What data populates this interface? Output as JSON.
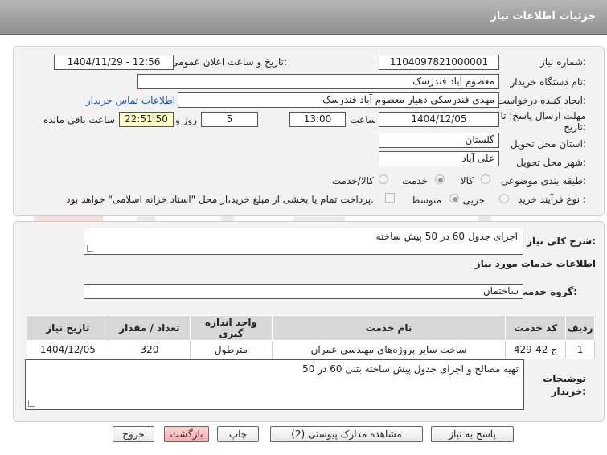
{
  "header": {
    "title": "جزئیات اطلاعات نیاز"
  },
  "fields": {
    "need_number_label": "شماره نیاز:",
    "need_number": "1104097821000001",
    "announce_label": "تاریخ و ساعت اعلان عمومی:",
    "announce_value": "1404/11/29 - 12:56",
    "buyer_label": "نام دستگاه خریدار:",
    "buyer_value": "معصوم آباد فندرسک",
    "creator_label": "ایجاد کننده درخواست:",
    "creator_value": "مهدی فندرسکی دهیار معصوم آباد فندرسک",
    "contact_link": "اطلاعات تماس خریدار",
    "deadline_label_1": "مهلت ارسال پاسخ: تا",
    "deadline_label_2": "تاریخ:",
    "deadline_date": "1404/12/05",
    "hour_label": "ساعت",
    "deadline_time": "13:00",
    "days_value": "5",
    "days_label": "روز و",
    "remaining_time": "22:51:50",
    "remaining_label": "ساعت باقی مانده",
    "province_label": "استان محل تحویل:",
    "province_value": "گلستان",
    "city_label": "شهر محل تحویل:",
    "city_value": "علی آباد",
    "category_label": "طبقه بندی موضوعی:",
    "category_options": [
      "کالا",
      "خدمت",
      "کالا/خدمت"
    ],
    "process_label": "نوع فرآیند خرید :",
    "process_options": [
      "جزیی",
      "متوسط"
    ],
    "payment_note": "پرداخت تمام یا بخشی از مبلغ خرید،از محل \"اسناد خزانه اسلامی\" خواهد بود."
  },
  "description": {
    "label": "شرح کلی نیاز:",
    "value": "اجرای جدول 60 در 50 پیش ساخته"
  },
  "services": {
    "section_title": "اطلاعات خدمات مورد نیاز",
    "group_label": "گروه خدمت:",
    "group_value": "ساختمان",
    "columns": [
      "ردیف",
      "کد خدمت",
      "نام خدمت",
      "واحد اندازه گیری",
      "تعداد / مقدار",
      "تاریخ نیاز"
    ],
    "rows": [
      [
        "1",
        "ج-42-429",
        "ساخت سایر پروژه‌های مهندسی عمران",
        "مترطول",
        "320",
        "1404/12/05"
      ]
    ]
  },
  "buyer_notes": {
    "label_1": "توضیحات",
    "label_2": "خریدار:",
    "value": "تهیه مصالح و اجرای جدول پیش ساخته بتنی 60 در 50"
  },
  "buttons": {
    "reply": "پاسخ به نیاز",
    "view_docs": "مشاهده مدارک پیوستی (2)",
    "print": "چاپ",
    "back": "بازگشت",
    "exit": "خروج"
  },
  "watermark": {
    "text": "AriaTender.net"
  },
  "colors": {
    "header": "#9e9e9e",
    "link": "#1a55b5",
    "panel": "#f2f2f2",
    "danger_button": "#f3b0b0"
  }
}
